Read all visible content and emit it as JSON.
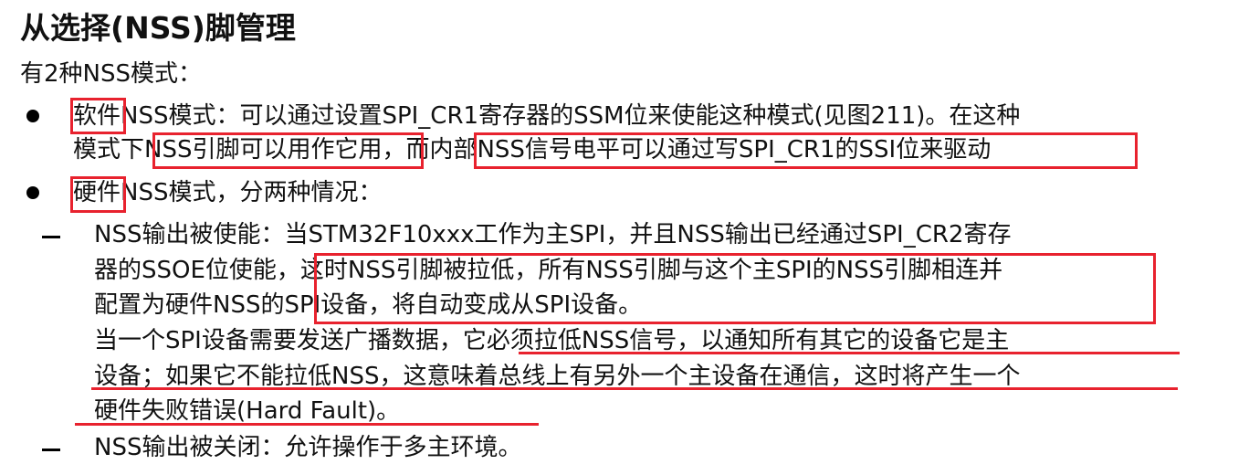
{
  "heading": "从选择(NSS)脚管理",
  "intro": "有2种NSS模式：",
  "bullet1": {
    "line1": "软件NSS模式：可以通过设置SPI_CR1寄存器的SSM位来使能这种模式(见图211)。在这种",
    "line2": "模式下NSS引脚可以用作它用，而内部NSS信号电平可以通过写SPI_CR1的SSI位来驱动"
  },
  "bullet2": {
    "line1": "硬件NSS模式，分两种情况："
  },
  "sub1": {
    "line1": "NSS输出被使能：当STM32F10xxx工作为主SPI，并且NSS输出已经通过SPI_CR2寄存",
    "line2": "器的SSOE位使能，这时NSS引脚被拉低，所有NSS引脚与这个主SPI的NSS引脚相连并",
    "line3": "配置为硬件NSS的SPI设备，将自动变成从SPI设备。",
    "line4": "当一个SPI设备需要发送广播数据，它必须拉低NSS信号，以通知所有其它的设备它是主",
    "line5": "设备；如果它不能拉低NSS，这意味着总线上有另外一个主设备在通信，这时将产生一个",
    "line6": "硬件失败错误(Hard Fault)。"
  },
  "sub2": {
    "line1": "NSS输出被关闭：允许操作于多主环境。"
  },
  "annotation_color": "#e8222e"
}
